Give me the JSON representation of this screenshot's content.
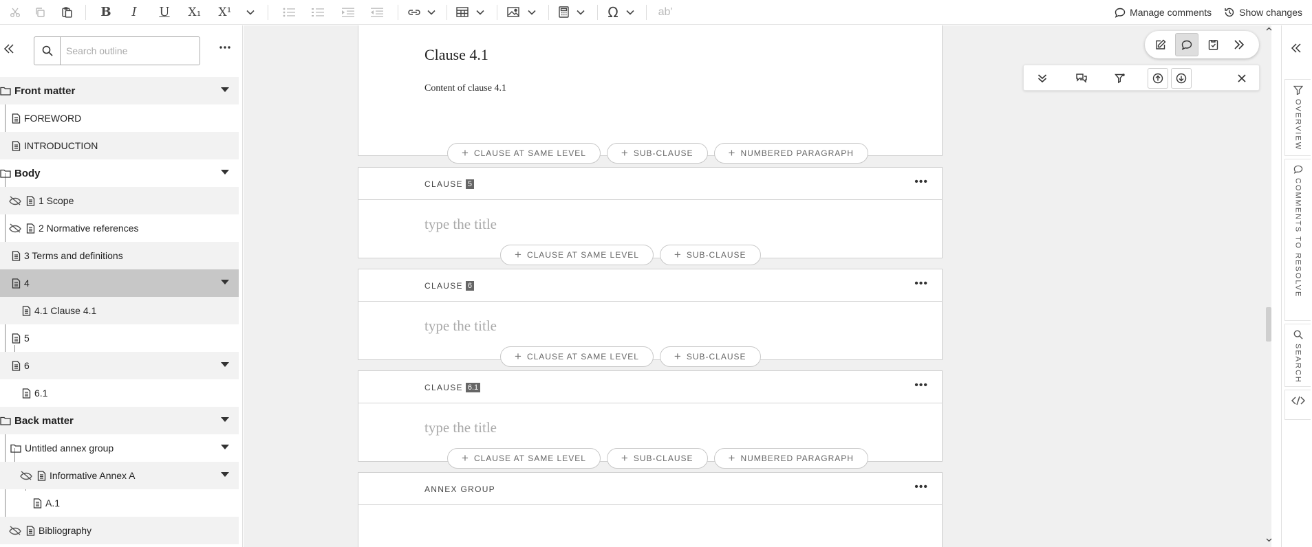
{
  "toolbar": {
    "manage_comments": "Manage comments",
    "show_changes": "Show changes",
    "subscript_label": "X₁",
    "superscript_label": "X¹",
    "bold_label": "B",
    "italic_label": "I",
    "underline_label": "U",
    "omega_label": "Ω",
    "spell_label": "ab'"
  },
  "outline": {
    "search_placeholder": "Search outline",
    "items": [
      {
        "label": "Front matter"
      },
      {
        "label": "FOREWORD"
      },
      {
        "label": "INTRODUCTION"
      },
      {
        "label": "Body"
      },
      {
        "label": "1 Scope"
      },
      {
        "label": "2 Normative references"
      },
      {
        "label": "3 Terms and definitions"
      },
      {
        "label": "4"
      },
      {
        "label": "4.1 Clause 4.1"
      },
      {
        "label": "5"
      },
      {
        "label": "6"
      },
      {
        "label": "6.1"
      },
      {
        "label": "Back matter"
      },
      {
        "label": "Untitled annex group"
      },
      {
        "label": "Informative Annex A"
      },
      {
        "label": "A.1"
      },
      {
        "label": "Bibliography"
      }
    ]
  },
  "editor": {
    "clause41": {
      "title": "Clause 4.1",
      "content": "Content of clause 4.1"
    },
    "kind_clause": "CLAUSE",
    "kind_annex_group": "ANNEX GROUP",
    "num5": "5",
    "num6": "6",
    "num61": "6.1",
    "title_placeholder": "type the title",
    "dots": "•••",
    "btn_same_level": "CLAUSE AT SAME LEVEL",
    "btn_sub_clause": "SUB-CLAUSE",
    "btn_numbered_para": "NUMBERED PARAGRAPH",
    "plus": "+"
  },
  "rail": {
    "overview": "OVERVIEW",
    "comments": "COMMENTS TO RESOLVE",
    "search": "SEARCH"
  }
}
